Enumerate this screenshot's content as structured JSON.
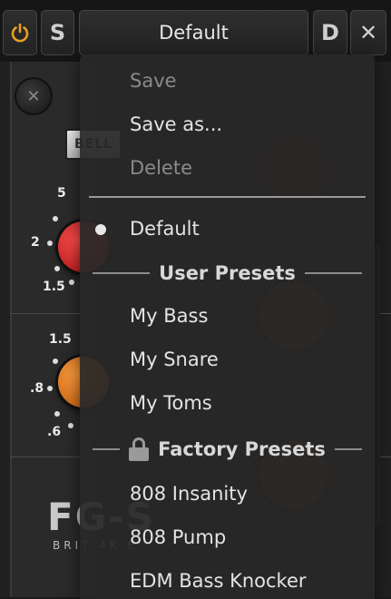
{
  "toolbar": {
    "power_icon": "power-icon",
    "s_label": "S",
    "preset_name": "Default",
    "d_label": "D",
    "close_glyph": "✕",
    "accent_color": "#e8a020"
  },
  "background": {
    "bell_label": "BELL",
    "scale_upper": [
      "5",
      "2",
      "1.5"
    ],
    "scale_lower": [
      "1.5",
      ".8",
      ".6"
    ],
    "brand_title": "FG-S",
    "brand_subtitle": "BRIT 4K E"
  },
  "menu": {
    "actions": [
      {
        "label": "Save",
        "enabled": false
      },
      {
        "label": "Save as...",
        "enabled": true
      },
      {
        "label": "Delete",
        "enabled": false
      }
    ],
    "selected": "Default",
    "default_item": "Default",
    "user_section": "User Presets",
    "user_presets": [
      "My Bass",
      "My Snare",
      "My Toms"
    ],
    "factory_section": "Factory Presets",
    "factory_presets": [
      "808 Insanity",
      "808 Pump",
      "EDM Bass Knocker"
    ]
  }
}
